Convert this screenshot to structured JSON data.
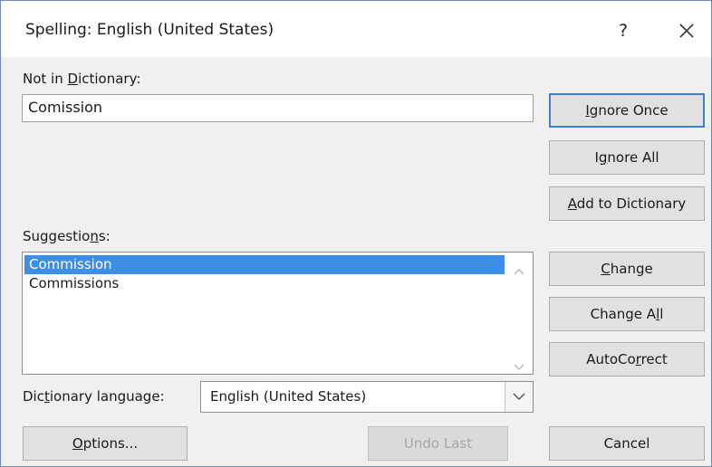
{
  "dialog": {
    "title": "Spelling: English (United States)",
    "help_label": "?"
  },
  "not_in_dictionary": {
    "label_pre": "Not in ",
    "label_key": "D",
    "label_post": "ictionary:",
    "value": "Comission"
  },
  "suggestions": {
    "label_pre": "Suggestio",
    "label_key": "n",
    "label_post": "s:",
    "items": [
      "Commission",
      "Commissions"
    ],
    "selected_index": 0
  },
  "language": {
    "label_pre": "Dic",
    "label_key": "t",
    "label_post": "ionary language:",
    "value": "English (United States)"
  },
  "buttons": {
    "ignore_once": {
      "pre": "",
      "key": "I",
      "post": "gnore Once"
    },
    "ignore_all": {
      "pre": "I",
      "key": "g",
      "post": "nore All"
    },
    "add_to_dictionary": {
      "pre": "",
      "key": "A",
      "post": "dd to Dictionary"
    },
    "change": {
      "pre": "",
      "key": "C",
      "post": "hange"
    },
    "change_all": {
      "pre": "Change A",
      "key": "l",
      "post": "l"
    },
    "autocorrect": {
      "pre": "AutoCo",
      "key": "r",
      "post": "rect"
    },
    "options": {
      "pre": "",
      "key": "O",
      "post": "ptions..."
    },
    "undo_last": {
      "label": "Undo Last"
    },
    "cancel": {
      "label": "Cancel"
    }
  },
  "colors": {
    "accent": "#3d8ee6",
    "default_button_border": "#3c7fd6",
    "dialog_background": "#f0f0f0"
  }
}
